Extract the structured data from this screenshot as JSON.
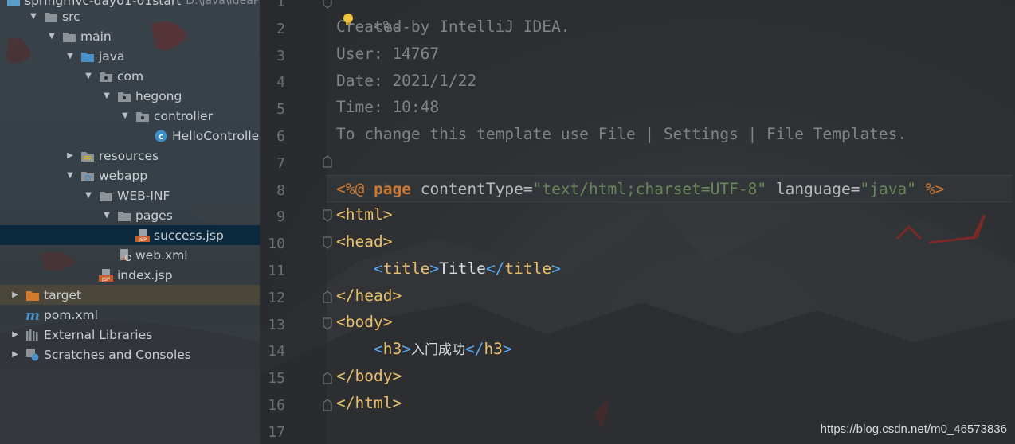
{
  "project_tree": {
    "root_partial_label": "springmvc-day01-01start",
    "root_partial_path": "D:\\java\\IdeaProjects",
    "items": [
      {
        "label": "src",
        "icon": "folder-icon",
        "expanded": true
      },
      {
        "label": "main",
        "icon": "folder-icon",
        "expanded": true
      },
      {
        "label": "java",
        "icon": "source-folder-icon",
        "expanded": true
      },
      {
        "label": "com",
        "icon": "package-icon",
        "expanded": true
      },
      {
        "label": "hegong",
        "icon": "package-icon",
        "expanded": true
      },
      {
        "label": "controller",
        "icon": "package-icon",
        "expanded": true
      },
      {
        "label": "HelloController",
        "icon": "java-class-icon"
      },
      {
        "label": "resources",
        "icon": "resources-folder-icon",
        "expanded": false
      },
      {
        "label": "webapp",
        "icon": "web-folder-icon",
        "expanded": true
      },
      {
        "label": "WEB-INF",
        "icon": "folder-icon",
        "expanded": true
      },
      {
        "label": "pages",
        "icon": "folder-icon",
        "expanded": true
      },
      {
        "label": "success.jsp",
        "icon": "jsp-file-icon",
        "selected": true
      },
      {
        "label": "web.xml",
        "icon": "xml-file-icon"
      },
      {
        "label": "index.jsp",
        "icon": "jsp-file-icon"
      },
      {
        "label": "target",
        "icon": "excluded-folder-icon",
        "expanded": false
      },
      {
        "label": "pom.xml",
        "icon": "maven-icon"
      },
      {
        "label": "External Libraries",
        "icon": "libraries-icon",
        "expanded": false
      },
      {
        "label": "Scratches and Consoles",
        "icon": "scratches-icon",
        "expanded": false
      }
    ]
  },
  "editor": {
    "line_numbers": [
      "1",
      "2",
      "3",
      "4",
      "5",
      "6",
      "7",
      "8",
      "9",
      "10",
      "11",
      "12",
      "13",
      "14",
      "15",
      "16",
      "17"
    ],
    "comment_open": "<%--",
    "comment_lines": [
      "Created by IntelliJ IDEA.",
      "User: 14767",
      "Date: 2021/1/22",
      "Time: 10:48",
      "To change this template use File | Settings | File Templates."
    ],
    "comment_close": "--%>",
    "directive": {
      "open": "<%@",
      "keyword": "page",
      "attr1": "contentType",
      "val1": "\"text/html;charset=UTF-8\"",
      "attr2": "language",
      "val2": "\"java\"",
      "close": "%>"
    },
    "tags": {
      "html": "html",
      "head": "head",
      "title": "title",
      "title_text": "Title",
      "body": "body",
      "h3": "h3",
      "h3_text": "入门成功"
    }
  },
  "watermark": "https://blog.csdn.net/m0_46573836",
  "colors": {
    "selection": "#0d293e",
    "jsp_directive": "#cc7832",
    "string": "#6a8759",
    "tag": "#e8bf6a",
    "comment": "#7f848a"
  }
}
